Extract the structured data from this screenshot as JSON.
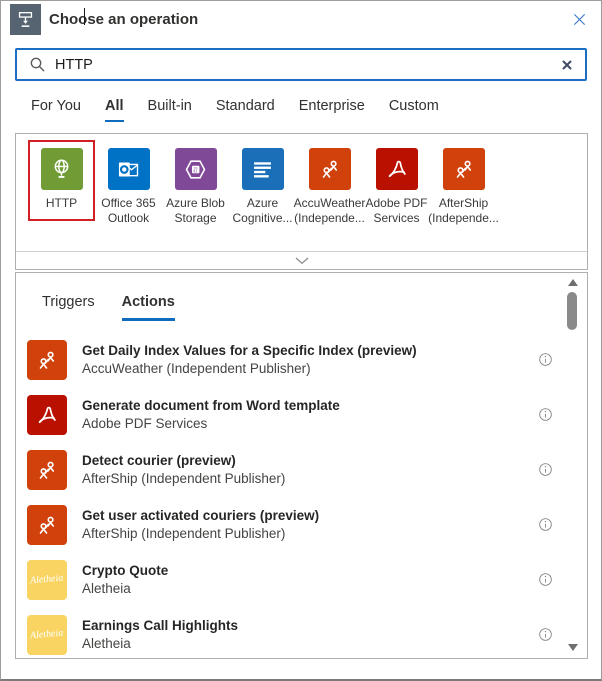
{
  "header": {
    "title": "Choose an operation"
  },
  "search": {
    "value": "HTTP"
  },
  "category_tabs": [
    {
      "label": "For You",
      "selected": false
    },
    {
      "label": "All",
      "selected": true
    },
    {
      "label": "Built-in",
      "selected": false
    },
    {
      "label": "Standard",
      "selected": false
    },
    {
      "label": "Enterprise",
      "selected": false
    },
    {
      "label": "Custom",
      "selected": false
    }
  ],
  "connector_tiles": [
    {
      "lines": [
        "HTTP"
      ],
      "icon": "globe-icon",
      "color": "#719c35",
      "selected": true
    },
    {
      "lines": [
        "Office 365",
        "Outlook"
      ],
      "icon": "outlook-icon",
      "color": "#0072c6",
      "selected": false
    },
    {
      "lines": [
        "Azure Blob",
        "Storage"
      ],
      "icon": "blob-storage-icon",
      "color": "#804998",
      "selected": false
    },
    {
      "lines": [
        "Azure",
        "Cognitive..."
      ],
      "icon": "text-lines-icon",
      "color": "#1a6fb8",
      "selected": false
    },
    {
      "lines": [
        "AccuWeather",
        "(Independe..."
      ],
      "icon": "independent-publisher-icon",
      "color": "#d1410c",
      "selected": false
    },
    {
      "lines": [
        "Adobe PDF",
        "Services"
      ],
      "icon": "adobe-icon",
      "color": "#b91000",
      "selected": false
    },
    {
      "lines": [
        "AfterShip",
        "(Independe..."
      ],
      "icon": "independent-publisher-icon",
      "color": "#d1410c",
      "selected": false
    }
  ],
  "operation_tabs": [
    {
      "label": "Triggers",
      "selected": false
    },
    {
      "label": "Actions",
      "selected": true
    }
  ],
  "actions": [
    {
      "title": "Get Daily Index Values for a Specific Index (preview)",
      "subtitle": "AccuWeather (Independent Publisher)",
      "icon": "independent-publisher-icon",
      "color": "#d1410c"
    },
    {
      "title": "Generate document from Word template",
      "subtitle": "Adobe PDF Services",
      "icon": "adobe-icon",
      "color": "#b91000"
    },
    {
      "title": "Detect courier (preview)",
      "subtitle": "AfterShip (Independent Publisher)",
      "icon": "independent-publisher-icon",
      "color": "#d1410c"
    },
    {
      "title": "Get user activated couriers (preview)",
      "subtitle": "AfterShip (Independent Publisher)",
      "icon": "independent-publisher-icon",
      "color": "#d1410c"
    },
    {
      "title": "Crypto Quote",
      "subtitle": "Aletheia",
      "icon": "aletheia-icon",
      "color": "#f9d462",
      "icon_text": "Aletheia"
    },
    {
      "title": "Earnings Call Highlights",
      "subtitle": "Aletheia",
      "icon": "aletheia-icon",
      "color": "#f9d462",
      "icon_text": "Aletheia"
    }
  ],
  "colors": {
    "accent": "#0f6cbd",
    "accent_border": "#1b6ec2",
    "selection_red": "#d02025",
    "header_icon_bg": "#566370"
  }
}
